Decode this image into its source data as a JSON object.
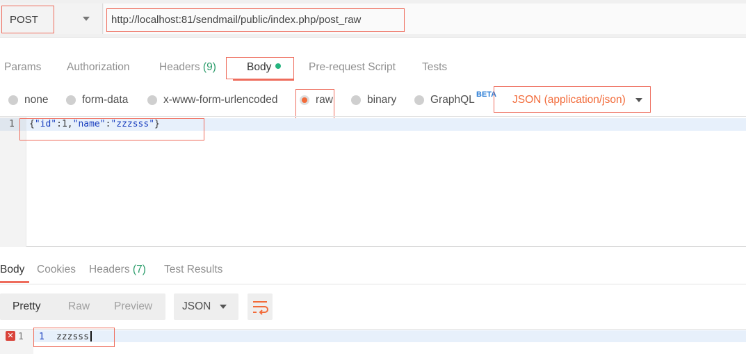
{
  "request": {
    "method": "POST",
    "url": "http://localhost:81/sendmail/public/index.php/post_raw"
  },
  "request_tabs": [
    {
      "label": "Params"
    },
    {
      "label": "Authorization"
    },
    {
      "label": "Headers",
      "count": "(9)"
    },
    {
      "label": "Body"
    },
    {
      "label": "Pre-request Script"
    },
    {
      "label": "Tests"
    }
  ],
  "body_modes": [
    {
      "label": "none"
    },
    {
      "label": "form-data"
    },
    {
      "label": "x-www-form-urlencoded"
    },
    {
      "label": "raw"
    },
    {
      "label": "binary"
    },
    {
      "label": "GraphQL"
    }
  ],
  "beta_badge": "BETA",
  "content_type": "JSON (application/json)",
  "editor": {
    "line_number": "1",
    "code_prefix": "{",
    "code_key1": "\"id\"",
    "code_mid1": ":1,",
    "code_key2": "\"name\"",
    "code_mid2": ":",
    "code_val2": "\"zzzsss\"",
    "code_suffix": "}"
  },
  "response_tabs": [
    {
      "label": "Body"
    },
    {
      "label": "Cookies"
    },
    {
      "label": "Headers",
      "count": "(7)"
    },
    {
      "label": "Test Results"
    }
  ],
  "view_modes": [
    {
      "label": "Pretty"
    },
    {
      "label": "Raw"
    },
    {
      "label": "Preview"
    }
  ],
  "response_format": "JSON",
  "response": {
    "error_glyph": "✕",
    "gutter_line_number": "1",
    "line_number": "1",
    "text": "zzzsss"
  },
  "colors": {
    "accent": "#F26B3A",
    "annotation_red": "#EE6C5C",
    "count_green": "#2A9C6A",
    "status_dot": "#26B47F"
  },
  "icons": {
    "wrap": "wrap-lines-icon",
    "error": "error-icon"
  }
}
